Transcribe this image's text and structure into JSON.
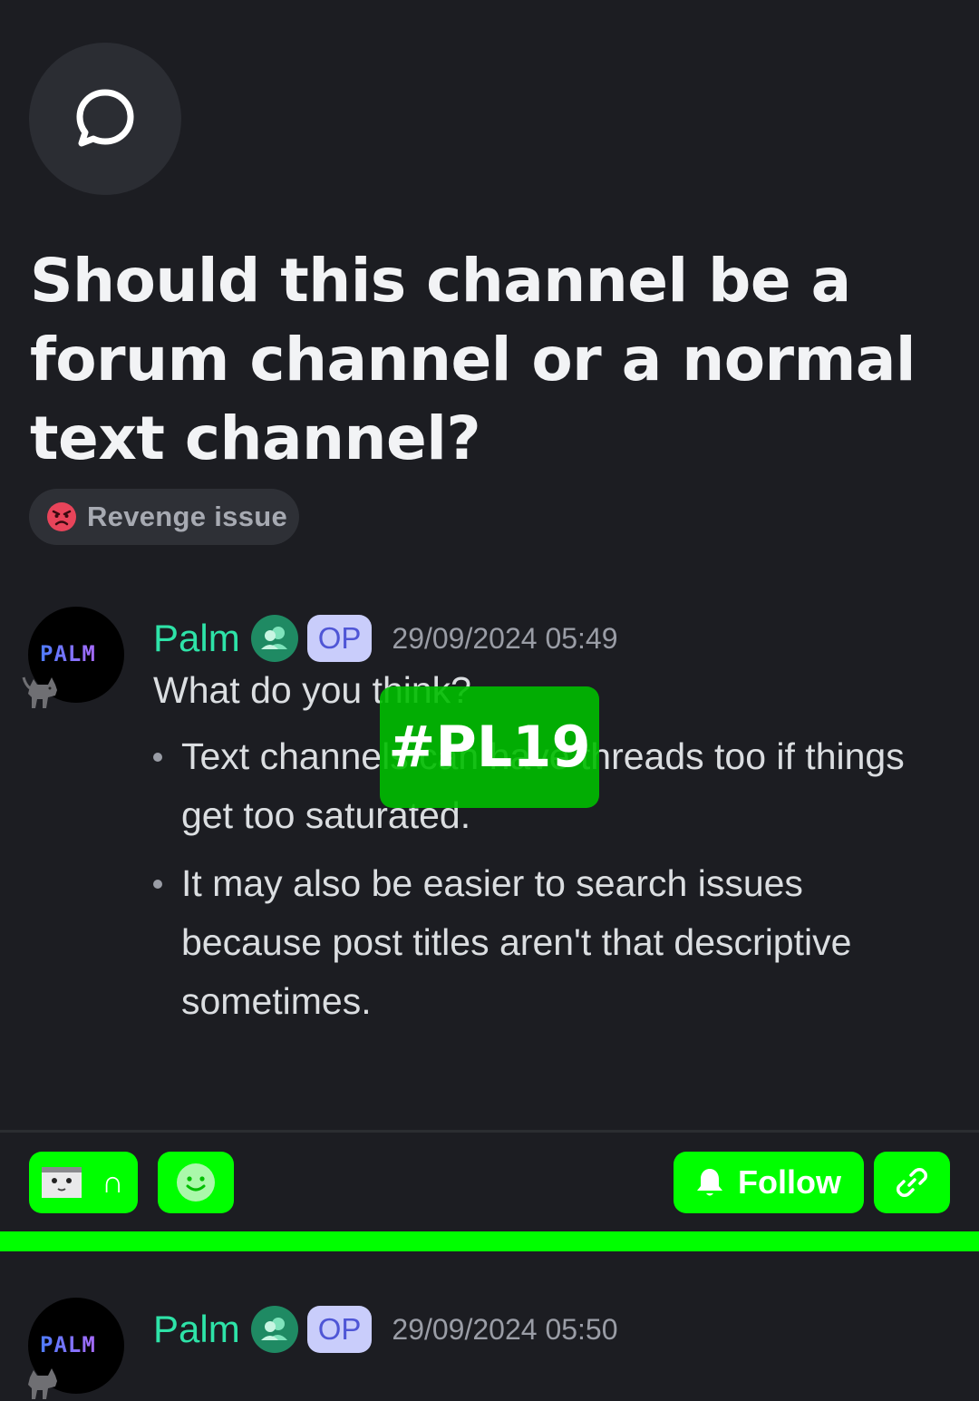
{
  "thread": {
    "title": "Should this channel be a forum channel or a normal text channel?",
    "tag": {
      "label": "Revenge issue",
      "icon": "angry-face-icon"
    }
  },
  "messages": [
    {
      "author": "Palm",
      "avatar_text": "PALM",
      "badge": "OP",
      "timestamp": "29/09/2024 05:49",
      "text": "What do you think?",
      "bullets": [
        "Text channels can have threads too if things get too saturated.",
        "It may also be easier to search issues because post titles aren't that descriptive sometimes."
      ]
    },
    {
      "author": "Palm",
      "avatar_text": "PALM",
      "badge": "OP",
      "timestamp": "29/09/2024 05:50"
    }
  ],
  "overlay_label": "#PL19",
  "actions": {
    "reaction_count": "∩",
    "follow_label": "Follow"
  },
  "colors": {
    "background": "#1c1d22",
    "author": "#2ee3a8",
    "op_badge_bg": "#c9cdfb",
    "action_green": "#00ff00"
  }
}
